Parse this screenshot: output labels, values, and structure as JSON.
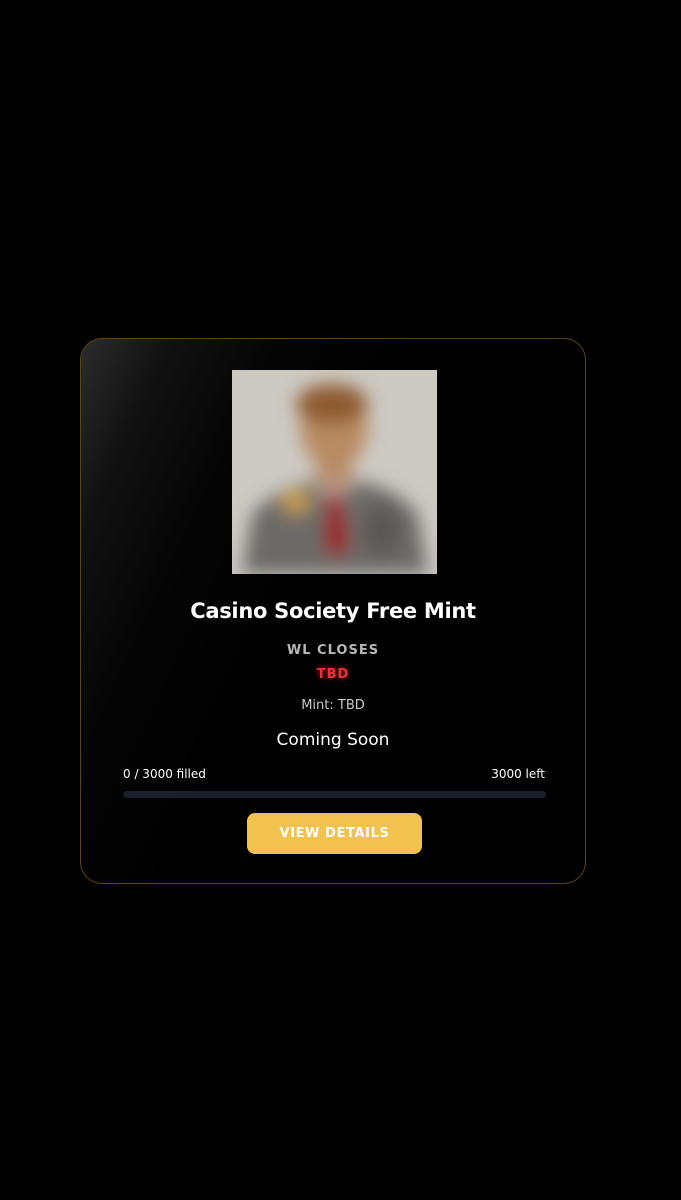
{
  "card": {
    "title": "Casino Society Free Mint",
    "wl_label": "WL CLOSES",
    "wl_value": "TBD",
    "mint": "Mint: TBD",
    "status": "Coming Soon",
    "progress": {
      "filled_text": "0 / 3000 filled",
      "left_text": "3000 left",
      "fraction": 0
    },
    "button_label": "VIEW DETAILS"
  },
  "colors": {
    "accent": "#f1c24d",
    "tbd_red": "#e8323a",
    "card_border": "#5a4516",
    "progress_track": "#1a1f29"
  }
}
